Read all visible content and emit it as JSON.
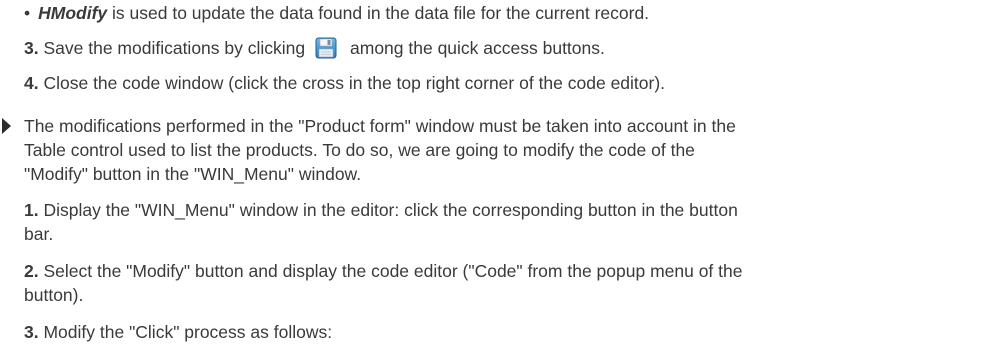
{
  "bullet": {
    "dot": "•",
    "keyword": "HModify",
    "text": " is used to update the data found in the data file for the current record."
  },
  "step3": {
    "num": "3.",
    "before": " Save the modifications by clicking",
    "icon": "save-floppy-icon",
    "after": " among the quick access buttons."
  },
  "step4": {
    "num": "4.",
    "text": " Close the code window (click the cross in the top right corner of the code editor)."
  },
  "intro": {
    "line1": "The modifications performed in the \"Product form\" window must be taken into account in the",
    "line2": "Table control used to list the products. To do so, we are going to modify the code of the",
    "line3": "\"Modify\" button in the \"WIN_Menu\" window."
  },
  "stepB1": {
    "num": "1.",
    "line1": " Display the \"WIN_Menu\" window in the editor: click the corresponding button in the button",
    "line2": "bar."
  },
  "stepB2": {
    "num": "2.",
    "line1": " Select the \"Modify\" button and display the code editor (\"Code\" from the popup menu of the",
    "line2": "button)."
  },
  "stepB3": {
    "num": "3.",
    "text": " Modify the \"Click\" process as follows:"
  }
}
